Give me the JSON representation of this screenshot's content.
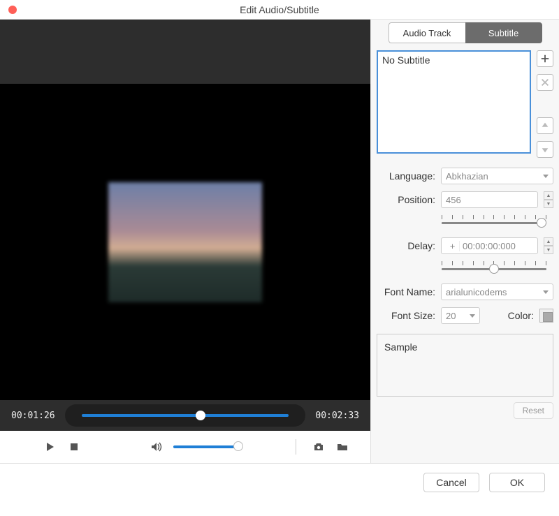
{
  "window": {
    "title": "Edit Audio/Subtitle"
  },
  "tabs": {
    "audio": "Audio Track",
    "subtitle": "Subtitle"
  },
  "subtitle_list": {
    "item0": "No Subtitle"
  },
  "labels": {
    "language": "Language:",
    "position": "Position:",
    "delay": "Delay:",
    "font_name": "Font Name:",
    "font_size": "Font Size:",
    "color": "Color:",
    "sample": "Sample",
    "reset": "Reset",
    "cancel": "Cancel",
    "ok": "OK"
  },
  "values": {
    "language": "Abkhazian",
    "position": "456",
    "delay_sign": "+",
    "delay": "00:00:00:000",
    "font_name": "arialunicodems",
    "font_size": "20"
  },
  "player": {
    "current": "00:01:26",
    "total": "00:02:33"
  }
}
